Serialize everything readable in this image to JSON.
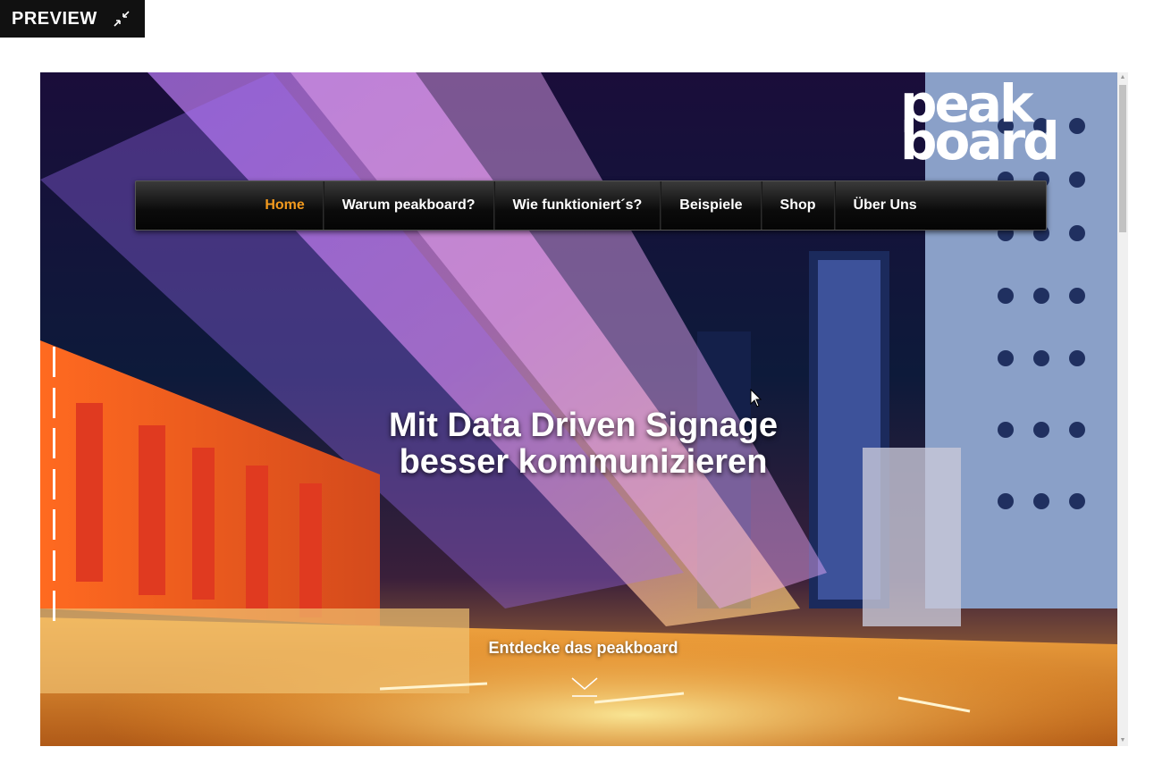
{
  "preview": {
    "label": "PREVIEW",
    "icon": "collapse-icon"
  },
  "logo": {
    "line1": "peak",
    "line2": "board"
  },
  "nav": {
    "items": [
      {
        "label": "Home",
        "active": true
      },
      {
        "label": "Warum peakboard?",
        "active": false
      },
      {
        "label": "Wie funktioniert´s?",
        "active": false
      },
      {
        "label": "Beispiele",
        "active": false
      },
      {
        "label": "Shop",
        "active": false
      },
      {
        "label": "Über Uns",
        "active": false
      }
    ]
  },
  "hero": {
    "headline_line1": "Mit Data Driven Signage",
    "headline_line2": "besser kommunizieren",
    "cta": "Entdecke das peakboard",
    "cta_icon": "chevron-down-icon"
  },
  "colors": {
    "accent": "#f39a1e",
    "nav_bg": "#111111",
    "text": "#ffffff"
  }
}
